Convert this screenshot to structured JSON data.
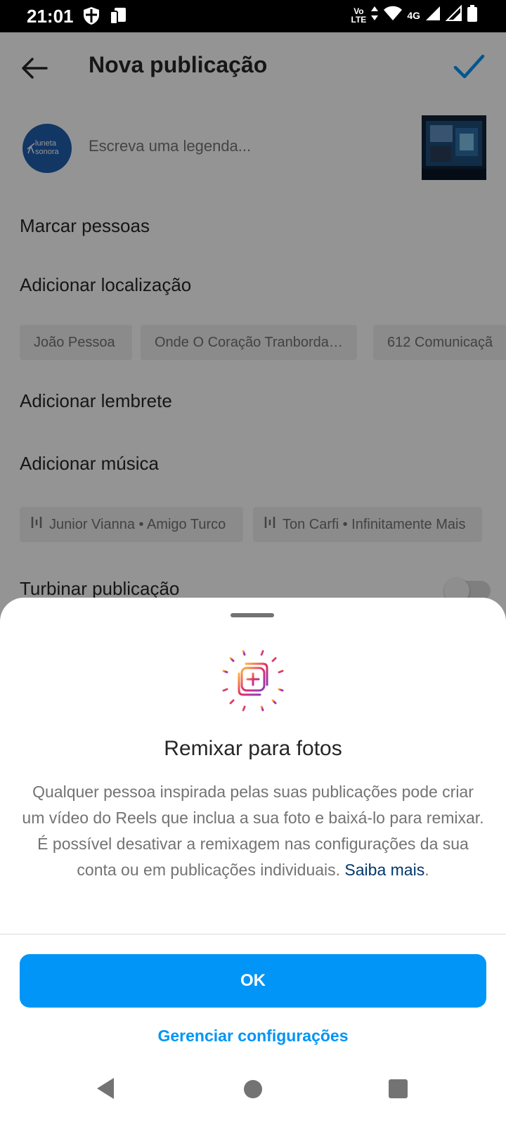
{
  "status_bar": {
    "time": "21:01",
    "network_label": "4G",
    "volte_line1": "Vo",
    "volte_line2": "LTE",
    "icons": [
      "shield-icon",
      "phone-tablet-icon",
      "data-arrows-icon",
      "wifi-icon",
      "signal-icon",
      "signal-icon",
      "battery-icon"
    ]
  },
  "header": {
    "title": "Nova publicação",
    "back_icon": "arrow-left-icon",
    "confirm_icon": "checkmark-icon"
  },
  "caption": {
    "placeholder": "Escreva uma legenda...",
    "avatar_line1": "luneta",
    "avatar_line2": "sonora"
  },
  "options": {
    "tag_people": "Marcar pessoas",
    "add_location": "Adicionar localização",
    "location_suggestions": [
      "João Pessoa",
      "Onde O Coração Tranborda…",
      "612 Comunicaçã"
    ],
    "add_reminder": "Adicionar lembrete",
    "add_music": "Adicionar música",
    "music_suggestions": [
      "Junior Vianna • Amigo Turco",
      "Ton Carfi • Infinitamente Mais"
    ],
    "boost_post": "Turbinar publicação",
    "boost_enabled": false
  },
  "sheet": {
    "icon": "remix-icon",
    "title": "Remixar para fotos",
    "body": "Qualquer pessoa inspirada pelas suas publicações pode criar um vídeo do Reels que inclua a sua foto e baixá-lo para remixar. É possível desativar a remixagem nas configurações da sua conta ou em publicações individuais.",
    "learn_more": "Saiba mais",
    "period": ".",
    "ok_label": "OK",
    "manage_label": "Gerenciar configurações"
  },
  "colors": {
    "accent_blue": "#0095f6",
    "link_dark_blue": "#00376b",
    "overlay": "rgba(0,0,0,0.42)"
  }
}
